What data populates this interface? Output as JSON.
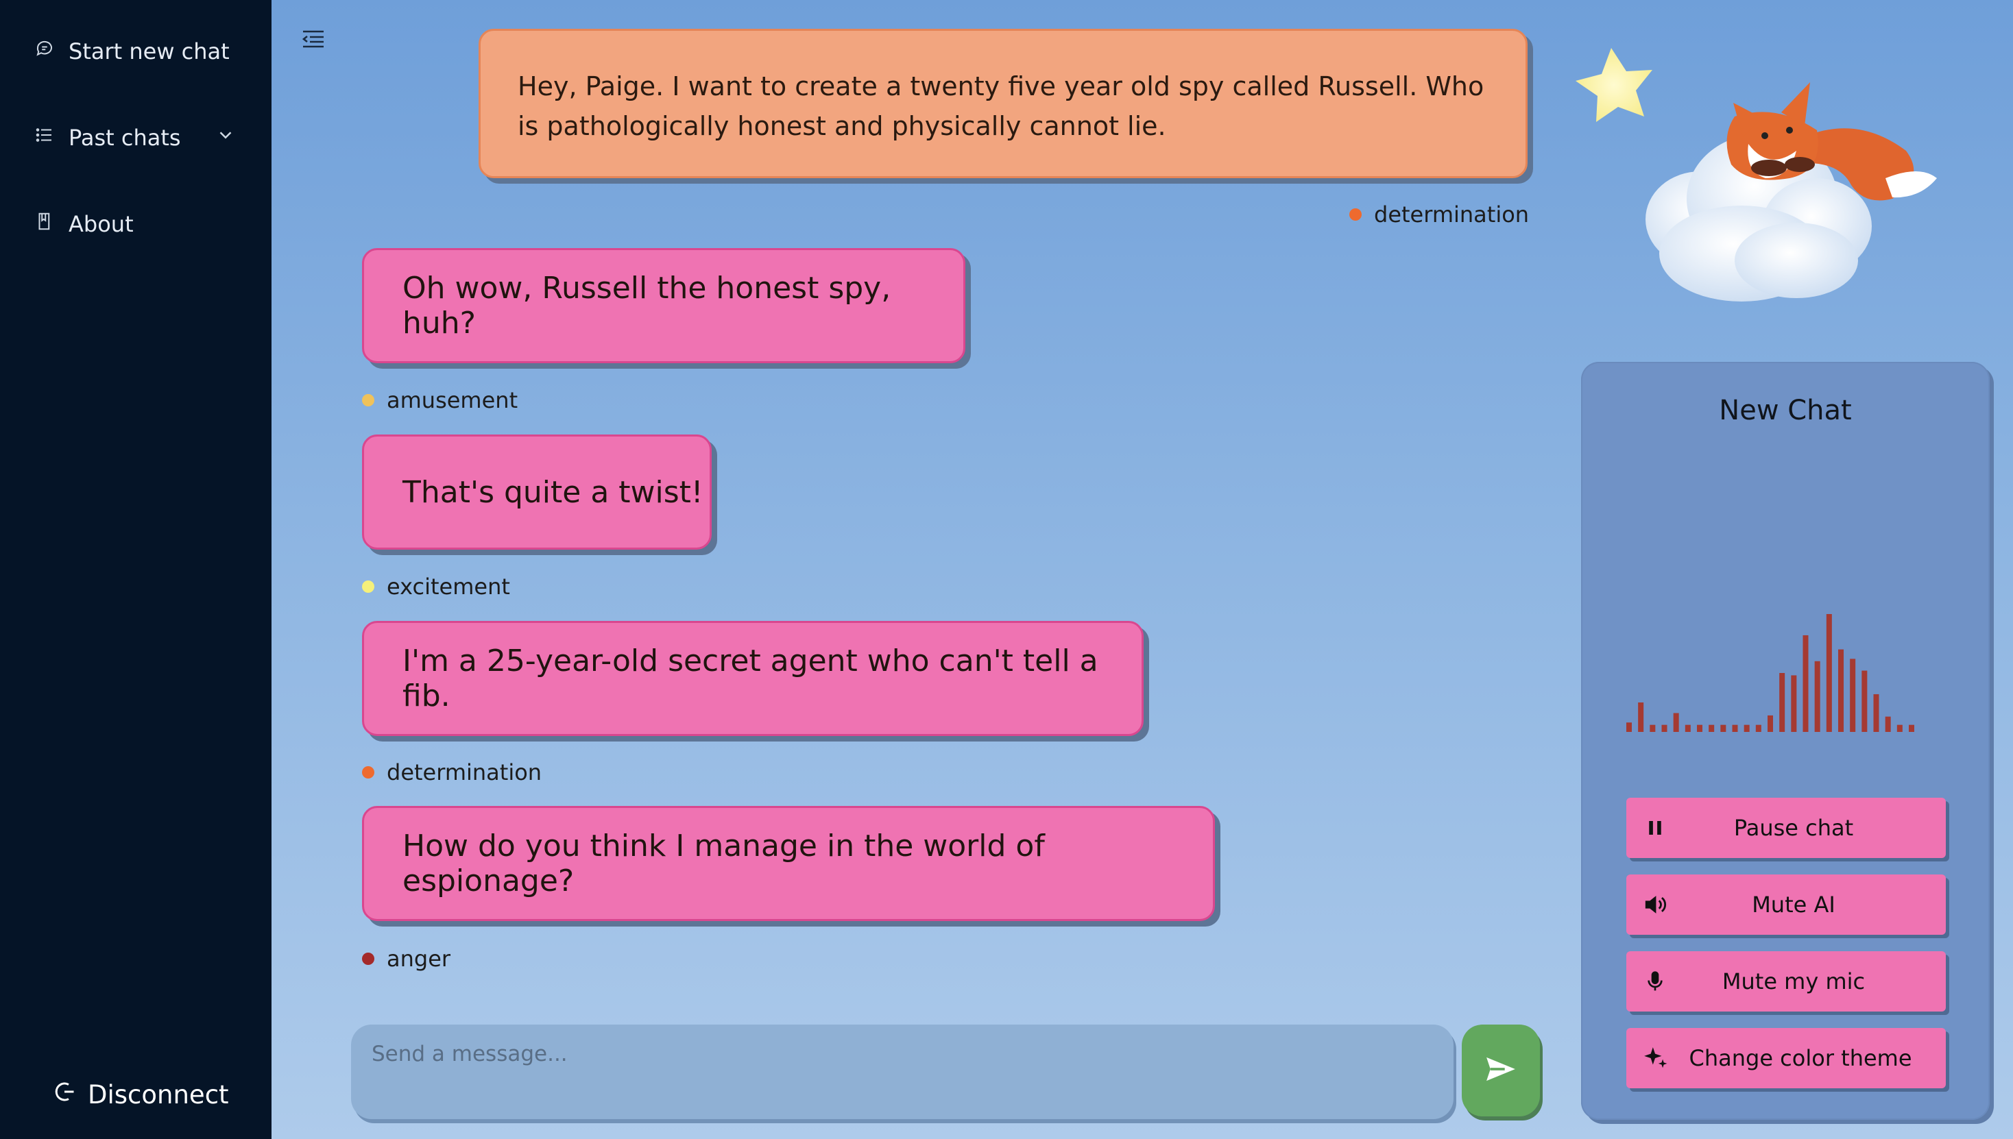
{
  "sidebar": {
    "items": [
      {
        "label": "Start new chat",
        "icon": "chat-bubble-icon"
      },
      {
        "label": "Past chats",
        "icon": "list-icon"
      },
      {
        "label": "About",
        "icon": "book-icon"
      }
    ],
    "disconnect_label": "Disconnect"
  },
  "chat": {
    "user_message": "Hey, Paige. I want to create a twenty five year old spy called Russell. Who is pathologically honest and physically cannot lie.",
    "user_emotion": "determination",
    "ai_messages": [
      {
        "text": "Oh wow, Russell the honest spy, huh?",
        "emotion": "amusement",
        "emotion_color": "#f0c25a"
      },
      {
        "text": "That's quite a twist!",
        "emotion": "excitement",
        "emotion_color": "#f5f07a"
      },
      {
        "text": "I'm a 25-year-old secret agent who can't tell a fib.",
        "emotion": "determination",
        "emotion_color": "#ee6a2e"
      },
      {
        "text": "How do you think I manage in the world of espionage?",
        "emotion": "anger",
        "emotion_color": "#a42a2a"
      }
    ]
  },
  "composer": {
    "placeholder": "Send a message..."
  },
  "panel": {
    "title": "New Chat",
    "buttons": [
      {
        "label": "Pause chat",
        "icon": "pause-icon"
      },
      {
        "label": "Mute AI",
        "icon": "speaker-icon"
      },
      {
        "label": "Mute my mic",
        "icon": "microphone-icon"
      },
      {
        "label": "Change color theme",
        "icon": "sparkle-icon"
      }
    ]
  },
  "colors": {
    "sidebar_bg": "#051427",
    "user_bubble": "#f2a57f",
    "ai_bubble": "#ef73b2",
    "send_button": "#62a85e",
    "visualizer_bar": "#a53a32"
  },
  "audio_levels": [
    0.08,
    0.25,
    0.06,
    0.06,
    0.16,
    0.06,
    0.06,
    0.06,
    0.06,
    0.06,
    0.06,
    0.06,
    0.14,
    0.5,
    0.48,
    0.82,
    0.6,
    1.0,
    0.7,
    0.62,
    0.52,
    0.32,
    0.13,
    0.06,
    0.06
  ]
}
